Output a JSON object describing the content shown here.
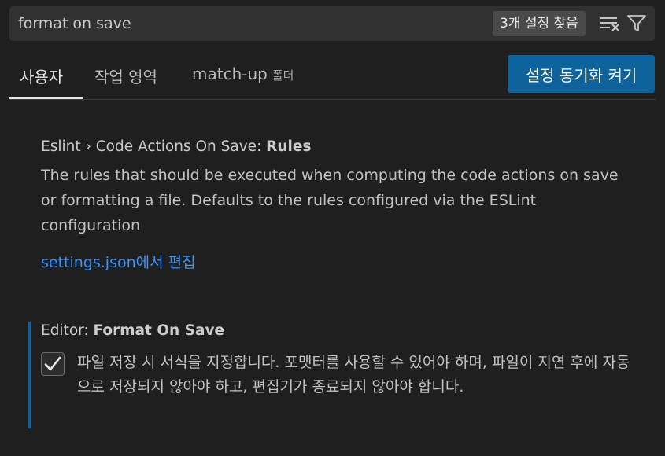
{
  "search": {
    "value": "format on save",
    "result_count": "3개 설정 찾음",
    "clear_filter_icon": "clear-filter-icon",
    "filter_icon": "filter-icon"
  },
  "tabs": [
    {
      "label": "사용자",
      "active": true
    },
    {
      "label": "작업 영역",
      "active": false
    },
    {
      "label": "match-up",
      "sublabel": "폴더",
      "active": false
    }
  ],
  "sync_button": {
    "label": "설정 동기화 켜기"
  },
  "settings": [
    {
      "category": "Eslint › Code Actions On Save: ",
      "name": "Rules",
      "description": "The rules that should be executed when computing the code actions on save or formatting a file. Defaults to the rules configured via the ESLint configuration",
      "link": "settings.json에서 편집"
    },
    {
      "category": "Editor: ",
      "name": "Format On Save",
      "checked": true,
      "description": "파일 저장 시 서식을 지정합니다. 포맷터를 사용할 수 있어야 하며, 파일이 지연 후에 자동으로 저장되지 않아야 하고, 편집기가 종료되지 않아야 합니다."
    }
  ],
  "colors": {
    "background": "#1f1f1f",
    "accent": "#0e639c",
    "link": "#3794ff"
  }
}
